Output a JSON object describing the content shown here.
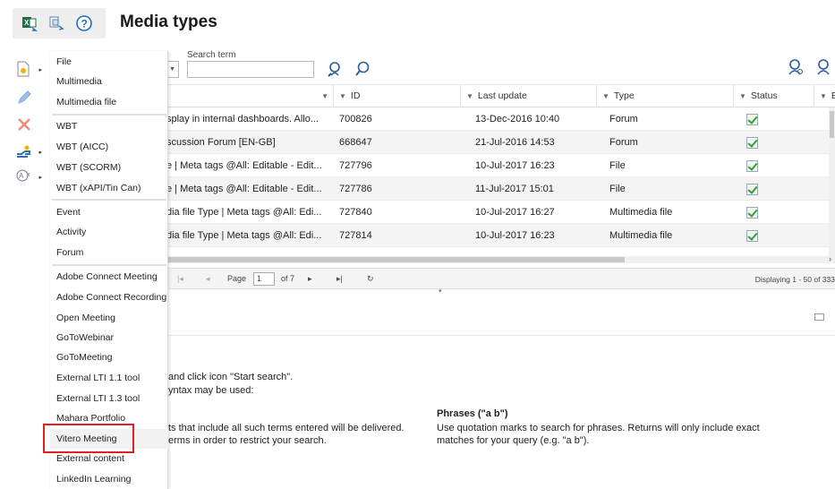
{
  "page": {
    "title": "Media types"
  },
  "toolbar": {
    "icons": [
      "excel-export-icon",
      "export-icon",
      "help-icon"
    ]
  },
  "search": {
    "label": "Search term",
    "value": ""
  },
  "menu": {
    "items": [
      "File",
      "Multimedia",
      "Multimedia file",
      "WBT",
      "WBT (AICC)",
      "WBT (SCORM)",
      "WBT (xAPI/Tin Can)",
      "Event",
      "Activity",
      "Forum",
      "Adobe Connect Meeting",
      "Adobe Connect Recording",
      "Open Meeting",
      "GoToWebinar",
      "GoToMeeting",
      "External LTI 1.1 tool",
      "External LTI 1.3 tool",
      "Mahara Portfolio",
      "Vitero Meeting",
      "External content",
      "LinkedIn Learning"
    ]
  },
  "grid": {
    "columns": [
      "ID",
      "Last update",
      "Type",
      "Status",
      "Ex"
    ],
    "rows": [
      {
        "name": "splay in internal dashboards. Allo...",
        "id": "700826",
        "updated": "13-Dec-2016 10:40",
        "type": "Forum"
      },
      {
        "name": "scussion Forum [EN-GB]",
        "id": "668647",
        "updated": "21-Jul-2016 14:53",
        "type": "Forum"
      },
      {
        "name": "e | Meta tags @All: Editable - Edit...",
        "id": "727796",
        "updated": "10-Jul-2017 16:23",
        "type": "File"
      },
      {
        "name": "e | Meta tags @All: Editable - Edit...",
        "id": "727786",
        "updated": "11-Jul-2017 15:01",
        "type": "File"
      },
      {
        "name": "dia file Type | Meta tags @All: Edi...",
        "id": "727840",
        "updated": "10-Jul-2017 16:27",
        "type": "Multimedia file"
      },
      {
        "name": "dia file Type | Meta tags @All: Edi...",
        "id": "727814",
        "updated": "10-Jul-2017 16:23",
        "type": "Multimedia file"
      }
    ]
  },
  "pager": {
    "page_label": "Page",
    "page_value": "1",
    "of_label": "of 7",
    "status": "Displaying 1 - 50 of 333"
  },
  "help": {
    "line1": "and click icon \"Start search\".",
    "line2": "yntax may be used:",
    "line3": "ts that include all such terms entered will be delivered.",
    "line4": "erms in order to restrict your search.",
    "phrases_heading": "Phrases (\"a b\")",
    "phrases_line1": "Use quotation marks to search for phrases. Returns will only include exact",
    "phrases_line2": "matches for your query (e.g. \"a b\")."
  },
  "colors": {
    "highlight": "#e02020",
    "check": "#3a9a3a",
    "accent": "#1f6fbf"
  }
}
